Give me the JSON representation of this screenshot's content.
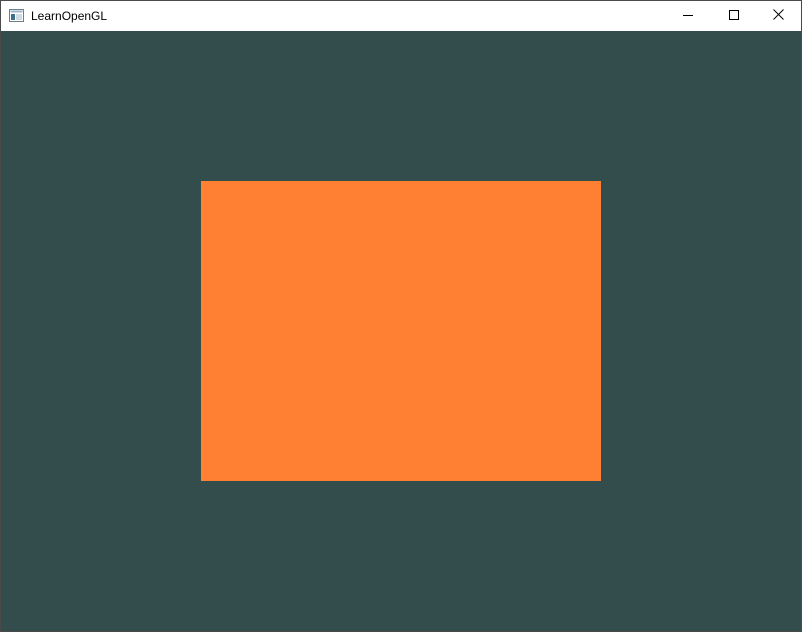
{
  "window": {
    "title": "LearnOpenGL",
    "icons": {
      "app": "app-window-icon",
      "minimize": "minimize-icon",
      "maximize": "maximize-icon",
      "close": "close-icon"
    }
  },
  "viewport": {
    "clear_color": "#334D4D",
    "rectangle_color": "#FF7F33"
  }
}
